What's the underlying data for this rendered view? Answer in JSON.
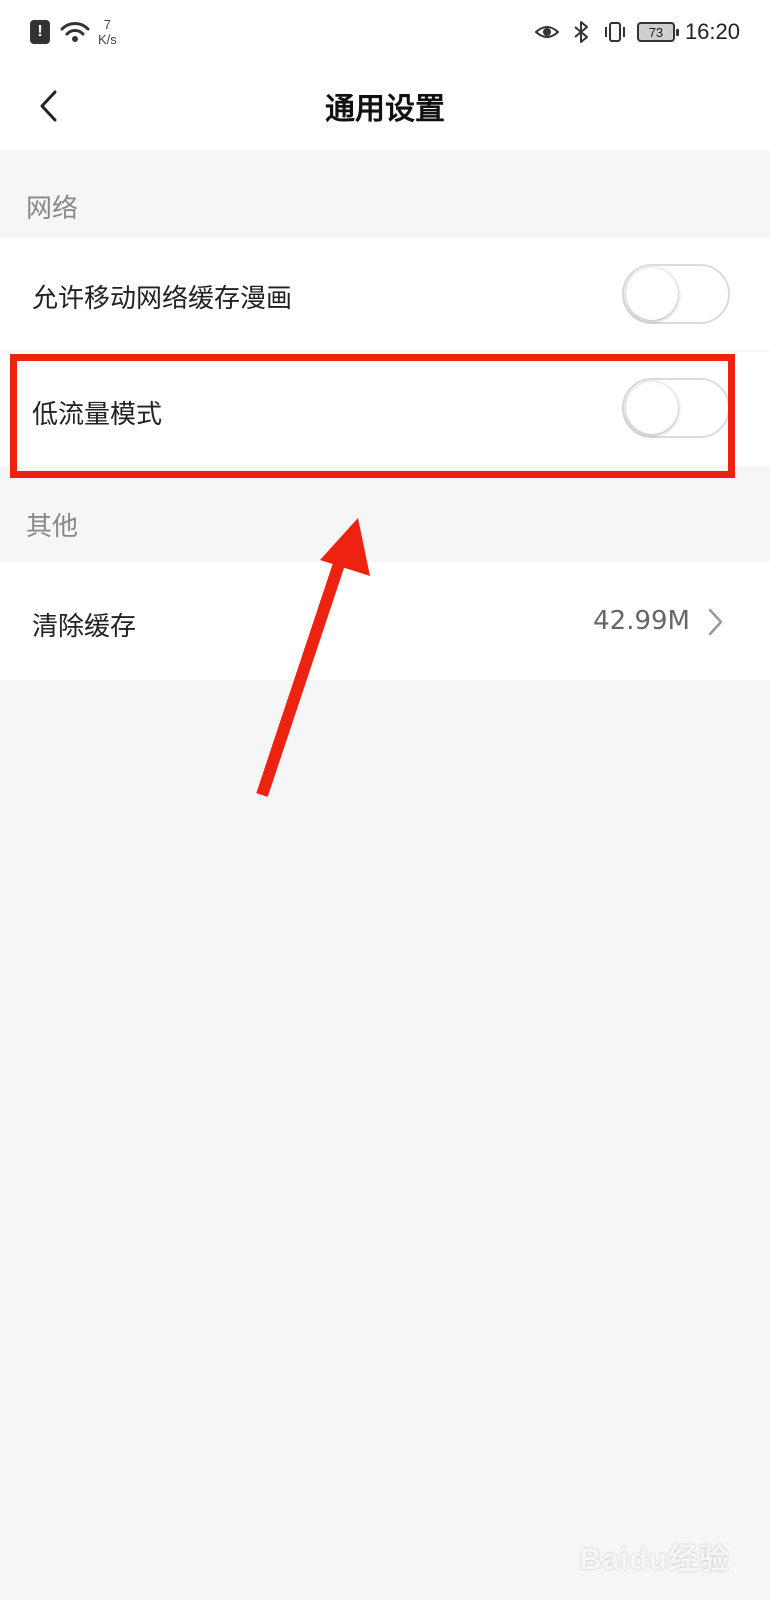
{
  "status_bar": {
    "net_speed_value": "7",
    "net_speed_unit": "K/s",
    "battery": "73",
    "time": "16:20",
    "icons": [
      "alert-icon",
      "wifi-icon",
      "eye-icon",
      "bluetooth-icon",
      "vibrate-icon",
      "battery-icon"
    ]
  },
  "header": {
    "title": "通用设置",
    "back_icon": "chevron-left-icon"
  },
  "sections": {
    "network": {
      "title": "网络",
      "items": [
        {
          "label": "允许移动网络缓存漫画",
          "toggle": false
        },
        {
          "label": "低流量模式",
          "toggle": false
        }
      ]
    },
    "other": {
      "title": "其他",
      "items": [
        {
          "label": "清除缓存",
          "value": "42.99M"
        }
      ]
    }
  },
  "annotation": {
    "highlight_color": "#ee2211"
  },
  "watermark": "Baidu经验"
}
